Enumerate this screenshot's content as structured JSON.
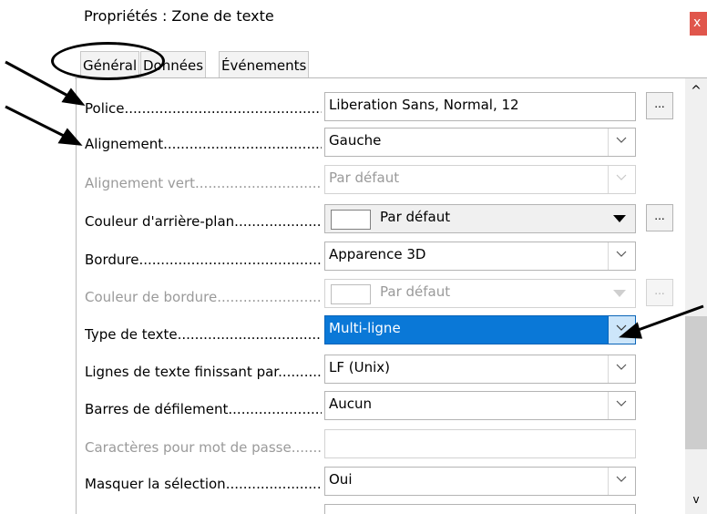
{
  "window": {
    "title": "Propriétés : Zone de texte",
    "close_label": "x"
  },
  "tabs": [
    {
      "label": "Général",
      "active": true
    },
    {
      "label": "Données",
      "active": false
    },
    {
      "label": "Événements",
      "active": false
    }
  ],
  "rows": [
    {
      "label": "Police",
      "value": "Liberation Sans, Normal, 12",
      "kind": "text-button",
      "button": "..."
    },
    {
      "label": "Alignement",
      "value": "Gauche",
      "kind": "dropdown"
    },
    {
      "label": "Alignement vert",
      "value": "Par défaut",
      "kind": "dropdown",
      "disabled": true
    },
    {
      "label": "Couleur d'arrière-plan",
      "value": "Par défaut",
      "kind": "color",
      "button": "..."
    },
    {
      "label": "Bordure",
      "value": "Apparence 3D",
      "kind": "dropdown"
    },
    {
      "label": "Couleur de bordure",
      "value": "Par défaut",
      "kind": "color",
      "button": "...",
      "disabled": true
    },
    {
      "label": "Type de texte",
      "value": "Multi-ligne",
      "kind": "dropdown",
      "selected": true
    },
    {
      "label": "Lignes de texte finissant par",
      "value": "LF (Unix)",
      "kind": "dropdown"
    },
    {
      "label": "Barres de défilement",
      "value": "Aucun",
      "kind": "dropdown"
    },
    {
      "label": "Caractères pour mot de passe",
      "value": "",
      "kind": "text",
      "disabled": true
    },
    {
      "label": "Masquer la sélection",
      "value": "Oui",
      "kind": "dropdown"
    }
  ],
  "scroll_up_glyph": "^",
  "scroll_down_glyph": "v",
  "colors": {
    "selected": "#0a78d7",
    "close": "#e0564c"
  }
}
